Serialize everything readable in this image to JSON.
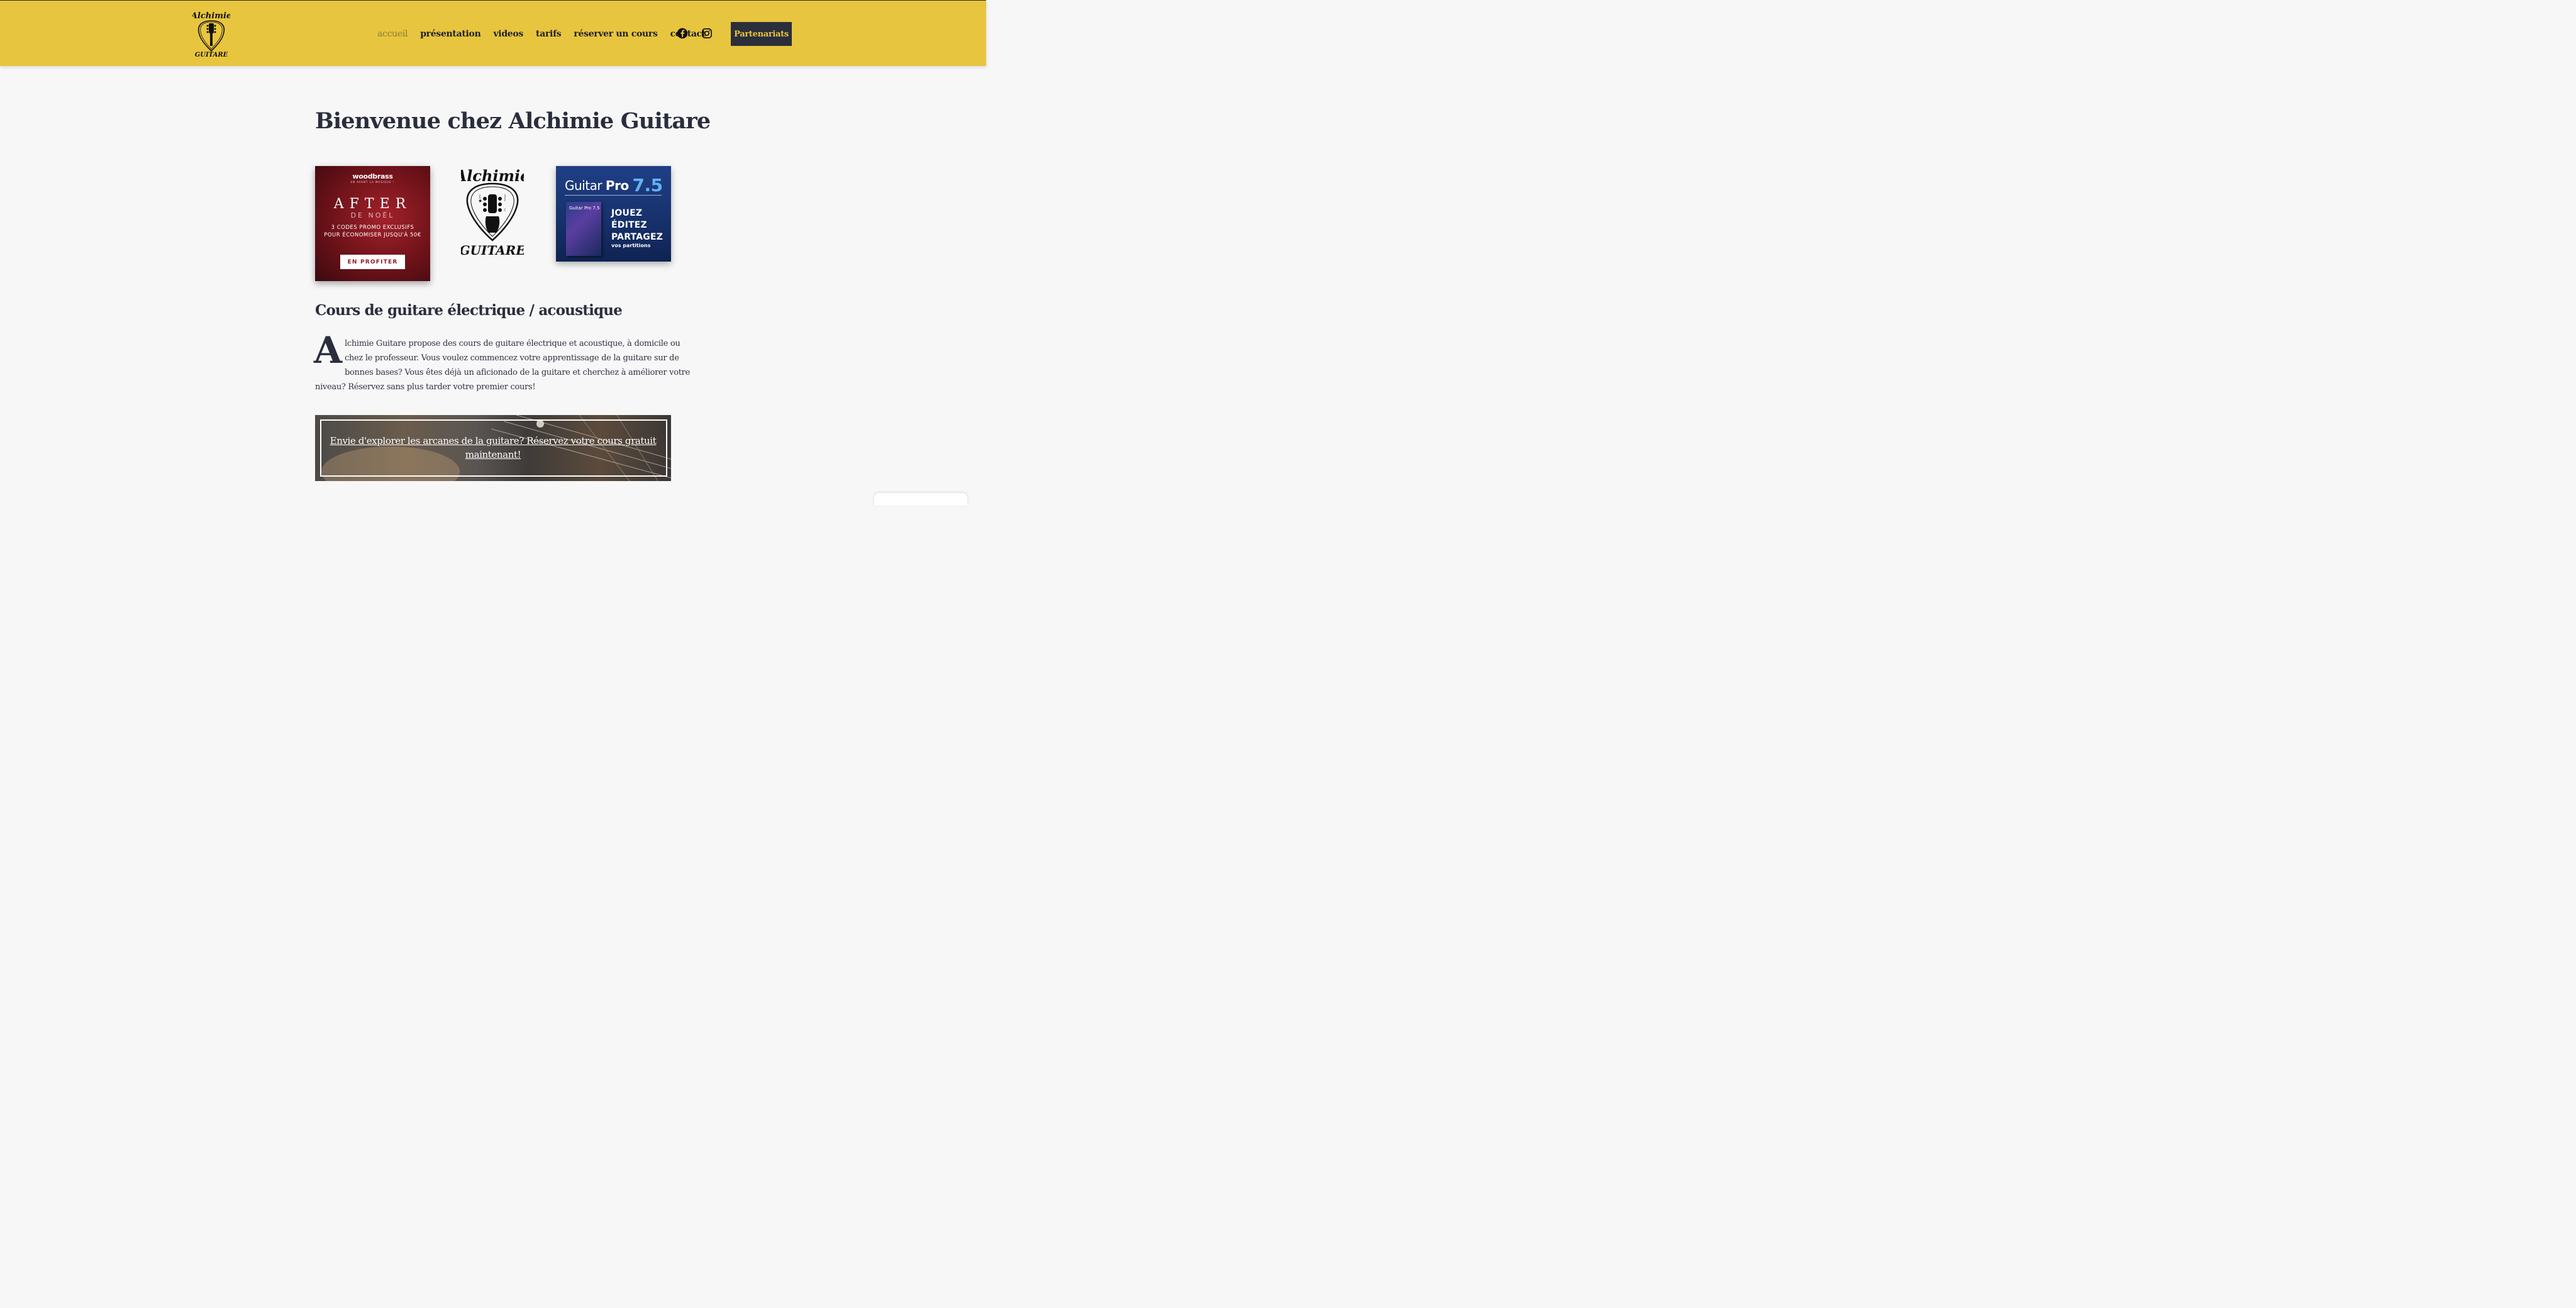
{
  "header": {
    "logo": {
      "name": "Alchimie",
      "sub": "GUITARE"
    },
    "nav": [
      {
        "label": "accueil",
        "active": true
      },
      {
        "label": "présentation",
        "active": false
      },
      {
        "label": "videos",
        "active": false
      },
      {
        "label": "tarifs",
        "active": false
      },
      {
        "label": "réserver un cours",
        "active": false
      },
      {
        "label": "contact",
        "active": false
      }
    ],
    "social_icons": [
      "facebook-icon",
      "instagram-icon"
    ],
    "partner_button": "Partenariats",
    "colors": {
      "bar": "#e8c53e",
      "button": "#2b2e3b"
    }
  },
  "main": {
    "title": "Bienvenue chez Alchimie Guitare",
    "ad_woodbrass": {
      "brand": "woodbrass",
      "brand_sub": "EN AVANT LA MUSIQUE !",
      "headline": "AFTER",
      "subheadline": "DE NOËL",
      "promo_line1": "3 CODES PROMO EXCLUSIFS",
      "promo_line2": "POUR ÉCONOMISER JUSQU'À 50€",
      "cta": "EN PROFITER"
    },
    "center_logo": {
      "name": "Alchimie",
      "sub": "GUITARE"
    },
    "ad_guitarpro": {
      "product": "Guitar",
      "product_bold": "Pro",
      "version": "7.5",
      "box_title": "Guitar Pro 7.5",
      "line1": "JOUEZ",
      "line2": "ÉDITEZ",
      "line3": "PARTAGEZ",
      "small": "vos partitions"
    },
    "section_title": "Cours de guitare électrique / acoustique",
    "dropcap": "A",
    "paragraph_lines": [
      "lchimie Guitare propose des cours de guitare électrique et acoustique, à domicile ou",
      "chez le professeur. Vous voulez commencez votre apprentissage de la guitare sur de",
      "bonnes bases? Vous êtes déjà un aficionado de la guitare et cherchez à améliorer votre",
      "niveau? Réservez sans plus tarder votre premier cours!"
    ],
    "banner_link": "Envie d'explorer les arcanes de la guitare? Réservez votre cours gratuit maintenant!"
  }
}
